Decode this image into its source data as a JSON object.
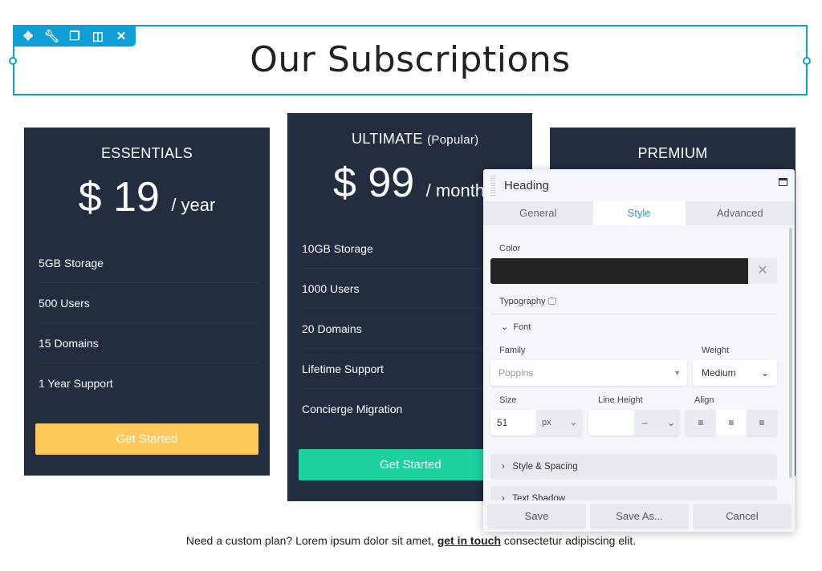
{
  "heading": {
    "title": "Our Subscriptions"
  },
  "toolbar": {
    "icons": [
      "move-icon",
      "wrench-icon",
      "duplicate-icon",
      "columns-icon",
      "close-icon"
    ],
    "accent": "#0e9fd6"
  },
  "plans": [
    {
      "title": "ESSENTIALS",
      "title_note": "",
      "price": "$ 19",
      "period": "/ year",
      "features": [
        "5GB Storage",
        "500 Users",
        "15 Domains",
        "1 Year Support"
      ],
      "button": "Get Started",
      "button_color": "#fec95a"
    },
    {
      "title": "ULTIMATE",
      "title_note": "(Popular)",
      "price": "$ 99",
      "period": "/ month",
      "features": [
        "10GB Storage",
        "1000 Users",
        "20 Domains",
        "Lifetime Support",
        "Concierge Migration"
      ],
      "button": "Get Started",
      "button_color": "#1dd1a1"
    },
    {
      "title": "PREMIUM"
    }
  ],
  "panel": {
    "title": "Heading",
    "tabs": [
      "General",
      "Style",
      "Advanced"
    ],
    "active_tab": "Style",
    "color_label": "Color",
    "color_value": "#222222",
    "typography_label": "Typography",
    "font_label": "Font",
    "family_label": "Family",
    "family_value": "Poppins",
    "weight_label": "Weight",
    "weight_value": "Medium",
    "size_label": "Size",
    "size_value": "51",
    "size_unit": "px",
    "line_height_label": "Line Height",
    "line_height_unit": "–",
    "align_label": "Align",
    "align_value": "center",
    "sections": [
      "Style & Spacing",
      "Text Shadow"
    ],
    "buttons": {
      "save": "Save",
      "save_as": "Save As...",
      "cancel": "Cancel"
    }
  },
  "footer": {
    "text_before": "Need a custom plan? Lorem ipsum dolor sit amet, ",
    "link": "get in touch",
    "text_after": " consectetur adipiscing elit."
  }
}
